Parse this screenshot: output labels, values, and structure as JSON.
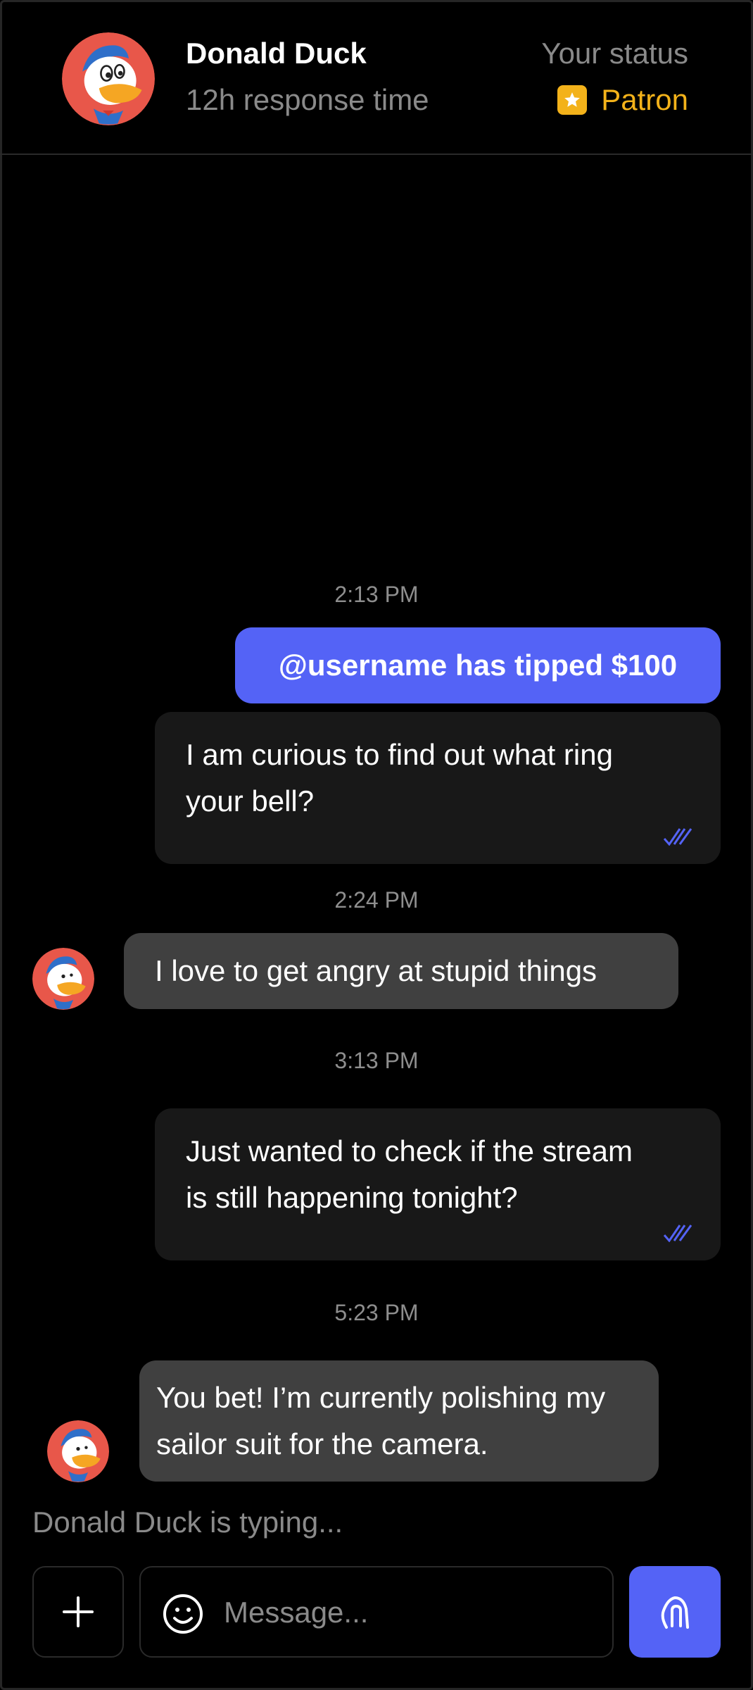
{
  "header": {
    "name": "Donald Duck",
    "response_time": "12h response time",
    "status_label": "Your status",
    "status_value": "Patron"
  },
  "messages": [
    {
      "time": "2:13 PM"
    },
    {
      "tip": "@username has tipped $100"
    },
    {
      "text_line1": "I am curious to find out what ring",
      "text_line2": "your bell?"
    },
    {
      "time": "2:24 PM"
    },
    {
      "text": "I love to get angry at stupid things"
    },
    {
      "time": "3:13 PM"
    },
    {
      "text_line1": "Just wanted to check if the stream",
      "text_line2": "is still happening tonight?"
    },
    {
      "time": "5:23 PM"
    },
    {
      "text_line1": "You bet! I’m currently polishing my",
      "text_line2": "sailor suit for the camera."
    }
  ],
  "typing_indicator": "Donald Duck is typing...",
  "composer": {
    "placeholder": "Message..."
  },
  "colors": {
    "accent": "#5463f6",
    "patron": "#f3b21a",
    "incoming": "#404040",
    "outgoing": "#181818"
  }
}
